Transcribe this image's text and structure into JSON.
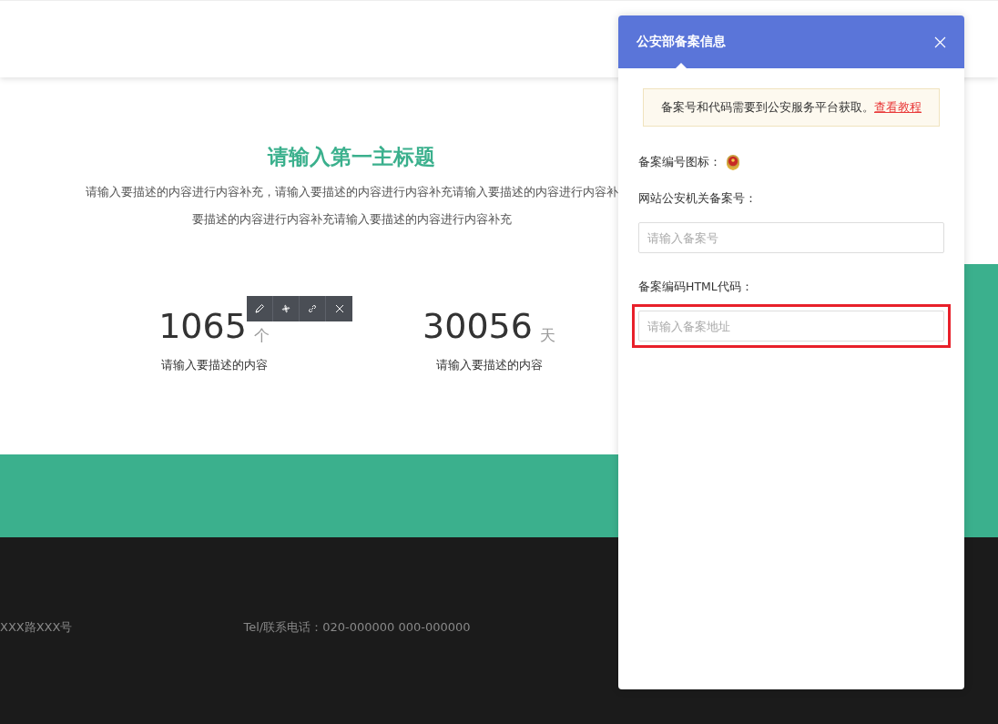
{
  "section": {
    "title": "请输入第一主标题",
    "description_lines": [
      "请输入要描述的内容进行内容补充，请输入要描述的内容进行内容补充请输入要描述的内容进行内容补",
      "要描述的内容进行内容补充请输入要描述的内容进行内容补充"
    ],
    "stats": [
      {
        "number": "1065",
        "unit": "个",
        "caption": "请输入要描述的内容"
      },
      {
        "number": "30056",
        "unit": "天",
        "caption": "请输入要描述的内容"
      }
    ]
  },
  "edit_toolbar": {
    "tools": [
      {
        "kind": "edit"
      },
      {
        "kind": "style"
      },
      {
        "kind": "link"
      },
      {
        "kind": "delete"
      }
    ]
  },
  "footer": {
    "address": "XXX路XXX号",
    "phone": "Tel/联系电话：020-000000 000-000000"
  },
  "dialog": {
    "title": "公安部备案信息",
    "notice": "备案号和代码需要到公安服务平台获取。",
    "notice_link": "查看教程",
    "icon_label": "备案编号图标：",
    "fields": [
      {
        "label": "网站公安机关备案号：",
        "placeholder": "请输入备案号",
        "highlighted": false
      },
      {
        "label": "备案编码HTML代码：",
        "placeholder": "请输入备案地址",
        "highlighted": true
      }
    ]
  }
}
